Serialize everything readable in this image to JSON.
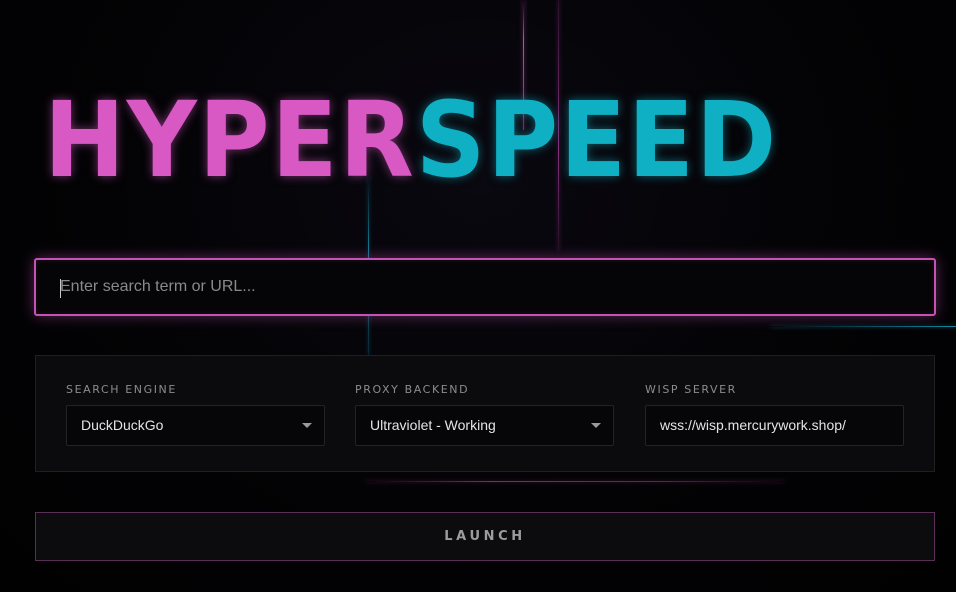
{
  "logo": {
    "part1": "HYPER",
    "part2": "SPEED",
    "colors": {
      "part1": "#d858c4",
      "part2": "#0fb0c4"
    }
  },
  "search": {
    "value": "",
    "placeholder": "Enter search term or URL..."
  },
  "settings": {
    "search_engine": {
      "label": "SEARCH ENGINE",
      "value": "DuckDuckGo"
    },
    "proxy_backend": {
      "label": "PROXY BACKEND",
      "value": "Ultraviolet - Working"
    },
    "wisp_server": {
      "label": "WISP SERVER",
      "value": "wss://wisp.mercurywork.shop/"
    }
  },
  "launch": {
    "label": "LAUNCH"
  },
  "icons": {
    "dropdown": "chevron-down-icon"
  }
}
